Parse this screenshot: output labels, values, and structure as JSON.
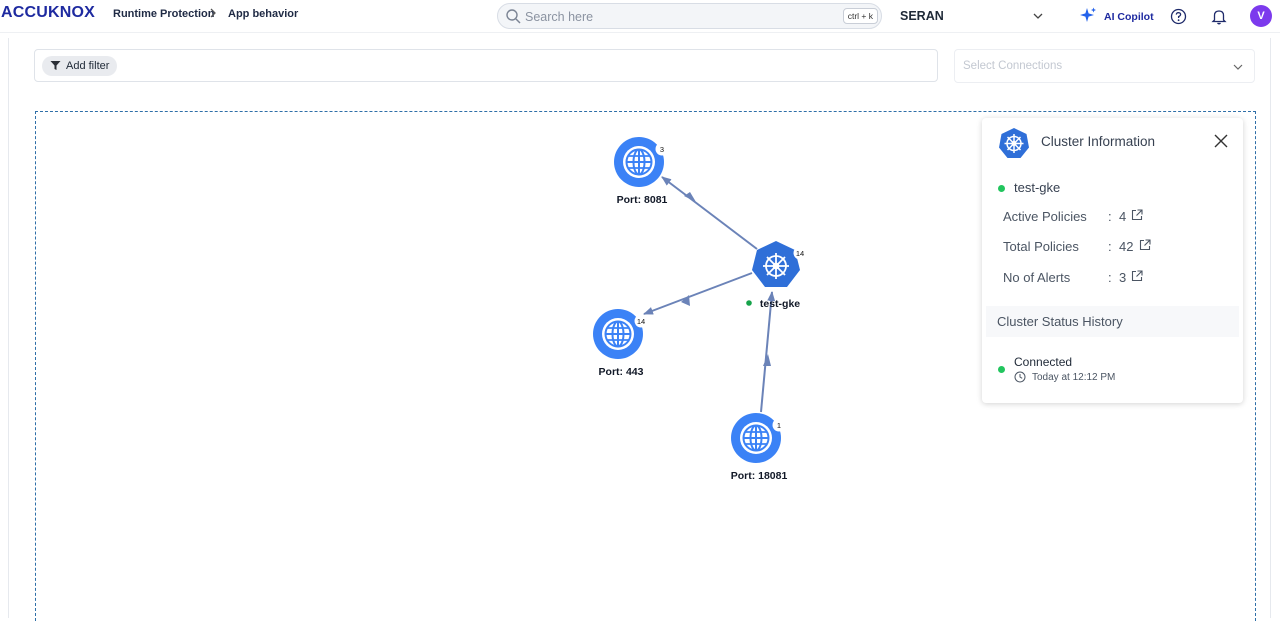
{
  "header": {
    "logo": "ACCUKNOX",
    "breadcrumb": [
      "Runtime Protection",
      "App behavior"
    ],
    "search_placeholder": "Search here",
    "search_shortcut": "ctrl + k",
    "tenant": "SERAN",
    "copilot_label": "AI Copilot",
    "avatar_initial": "V"
  },
  "toolbar": {
    "add_filter_label": "Add filter",
    "connections_placeholder": "Select Connections"
  },
  "graph": {
    "nodes": [
      {
        "id": "port-8081",
        "label": "Port: 8081",
        "badge": "3",
        "icon": "globe-icon"
      },
      {
        "id": "test-gke",
        "label": "test-gke",
        "badge": "14",
        "icon": "kubernetes-icon",
        "status_color": "#16a34a"
      },
      {
        "id": "port-443",
        "label": "Port: 443",
        "badge": "14",
        "icon": "globe-icon"
      },
      {
        "id": "port-18081",
        "label": "Port: 18081",
        "badge": "1",
        "icon": "globe-icon"
      }
    ],
    "edges": [
      {
        "from": "test-gke",
        "to": "port-8081"
      },
      {
        "from": "test-gke",
        "to": "port-443"
      },
      {
        "from": "port-18081",
        "to": "test-gke"
      }
    ]
  },
  "cluster_info": {
    "title": "Cluster Information",
    "cluster_name": "test-gke",
    "rows": [
      {
        "label": "Active Policies",
        "value": "4"
      },
      {
        "label": "Total Policies",
        "value": "42"
      },
      {
        "label": "No of Alerts",
        "value": "3"
      }
    ],
    "history_title": "Cluster Status History",
    "status": "Connected",
    "status_time": "Today at 12:12 PM",
    "status_color": "#22c55e"
  },
  "colors": {
    "brand": "#1e2aa0",
    "node_blue": "#3b82f6",
    "k8s_blue": "#2f6fd8",
    "edge": "#6b83b8",
    "dashed_border": "#2f6fa8"
  }
}
